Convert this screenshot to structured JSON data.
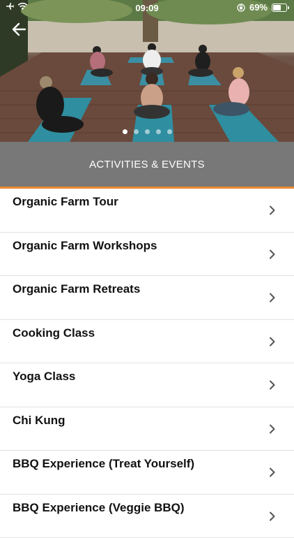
{
  "status": {
    "time": "09:09",
    "battery": "69%",
    "battery_level": 0.69
  },
  "hero": {
    "image": "yoga-class-photo",
    "slide_count": 5,
    "active_slide": 1
  },
  "header": {
    "title": "ACTIVITIES & EVENTS"
  },
  "colors": {
    "header_bg": "#787878",
    "accent": "#e8892f",
    "text": "#111111"
  },
  "items": [
    {
      "label": "Organic Farm Tour"
    },
    {
      "label": "Organic Farm Workshops"
    },
    {
      "label": "Organic Farm Retreats"
    },
    {
      "label": "Cooking Class"
    },
    {
      "label": "Yoga Class"
    },
    {
      "label": "Chi Kung"
    },
    {
      "label": "BBQ Experience (Treat Yourself)"
    },
    {
      "label": "BBQ Experience (Veggie BBQ)"
    }
  ]
}
